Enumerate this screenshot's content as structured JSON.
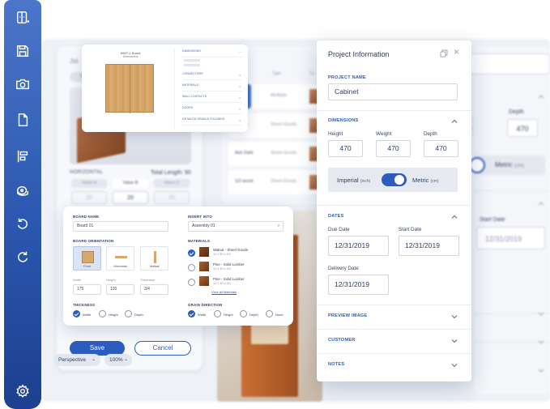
{
  "background": {
    "joint_title": "Joi",
    "joint_tab": "Ter",
    "horizontal_label": "HORIZONTAL",
    "total_length": "Total Length: 90",
    "values": [
      {
        "label": "Value A",
        "value": "20"
      },
      {
        "label": "Value B",
        "value": "20"
      },
      {
        "label": "Value C",
        "value": "20"
      }
    ],
    "materials_header": {
      "type": "Type",
      "cu": "Cu"
    },
    "materials_rows": [
      {
        "name": "ect",
        "type": "MUltiple"
      },
      {
        "name": "walnut",
        "type": "Sheet Goods"
      },
      {
        "name": "Ash Dark",
        "type": "Sheet Goods"
      },
      {
        "name": "1/2 wood",
        "type": "Sheet Goods"
      }
    ],
    "depth_label": "Depth",
    "depth_value": "470",
    "left_partial_value": "70",
    "metric_label": "Metric",
    "metric_unit": "(cm)",
    "start_date_label": "Start Date",
    "start_date_value": "12/31/2019"
  },
  "sidebar": {
    "icons": [
      "new-layout-icon",
      "save-icon",
      "camera-icon",
      "document-icon",
      "align-icon",
      "material-roll-icon",
      "undo-icon",
      "redo-icon",
      "settings-icon"
    ]
  },
  "board_preview": {
    "title": "MWT-1 Board",
    "subtitle": "Dimensions",
    "side_rows": [
      {
        "label": "DIMENSIONS"
      },
      {
        "label": "CONNECTORS"
      },
      {
        "label": "MATERIALS"
      },
      {
        "label": "WALL CONTACTS"
      },
      {
        "label": "DOORS"
      },
      {
        "label": "DETAILED GRAIN & FOLDINGS"
      }
    ]
  },
  "board_settings": {
    "board_name_label": "BOARD NAME",
    "board_name_value": "Board 01",
    "insert_into_label": "INSERT INTO",
    "insert_into_value": "Assembly 01",
    "orientation_label": "BOARD ORIENTATION",
    "orientations": [
      "Front",
      "Horizontal",
      "Vertical"
    ],
    "width_label": "Width",
    "width_value": "175",
    "height_label": "Height",
    "height_value": "120",
    "thickness_label": "Thickness",
    "thickness_value": "3/4",
    "thickness_section": "THICKNESS",
    "thickness_options": [
      "Width",
      "Height",
      "Depth"
    ],
    "materials_label": "MATERIALS",
    "materials": [
      {
        "name": "Walnut - Sheet Goods",
        "dims": "12 x 30 x 3/4"
      },
      {
        "name": "Pine - Solid Lumber",
        "dims": "12 x 30 x 3/4"
      },
      {
        "name": "Pine - Solid Lumber",
        "dims": "12 x 30 x 3/4"
      }
    ],
    "view_all": "View all Materials",
    "grain_label": "GRAIN DIRECTION",
    "grain_options": [
      "Width",
      "Height",
      "Depth",
      "None"
    ]
  },
  "bottom_bar": {
    "save": "Save",
    "cancel": "Cancel",
    "perspective": "Perspective",
    "zoom": "100%"
  },
  "project_panel": {
    "title": "Project Information",
    "project_name_label": "PROJECT NAME",
    "project_name_value": "Cabinet",
    "dimensions_label": "DIMENSIONS",
    "height_label": "Height",
    "height_value": "470",
    "weight_label": "Weight",
    "weight_value": "470",
    "depth_label": "Depth",
    "depth_value": "470",
    "imperial_label": "Imperial",
    "imperial_unit": "(inch)",
    "metric_label": "Metric",
    "metric_unit": "(cm)",
    "units_selected": "Metric",
    "dates_label": "DATES",
    "due_date_label": "Due Date",
    "due_date_value": "12/31/2019",
    "start_date_label": "Start Date",
    "start_date_value": "12/31/2019",
    "delivery_date_label": "Delivery Date",
    "delivery_date_value": "12/31/2019",
    "preview_image_label": "PREVIEW IMAGE",
    "customer_label": "CUSTOMER",
    "notes_label": "NOTES"
  },
  "colors": {
    "accent": "#2d5cbf",
    "sidebar_top": "#4b76c9",
    "sidebar_bottom": "#1d3f8f",
    "text_dark": "#2c3e66",
    "wood": "#d7a86c"
  }
}
